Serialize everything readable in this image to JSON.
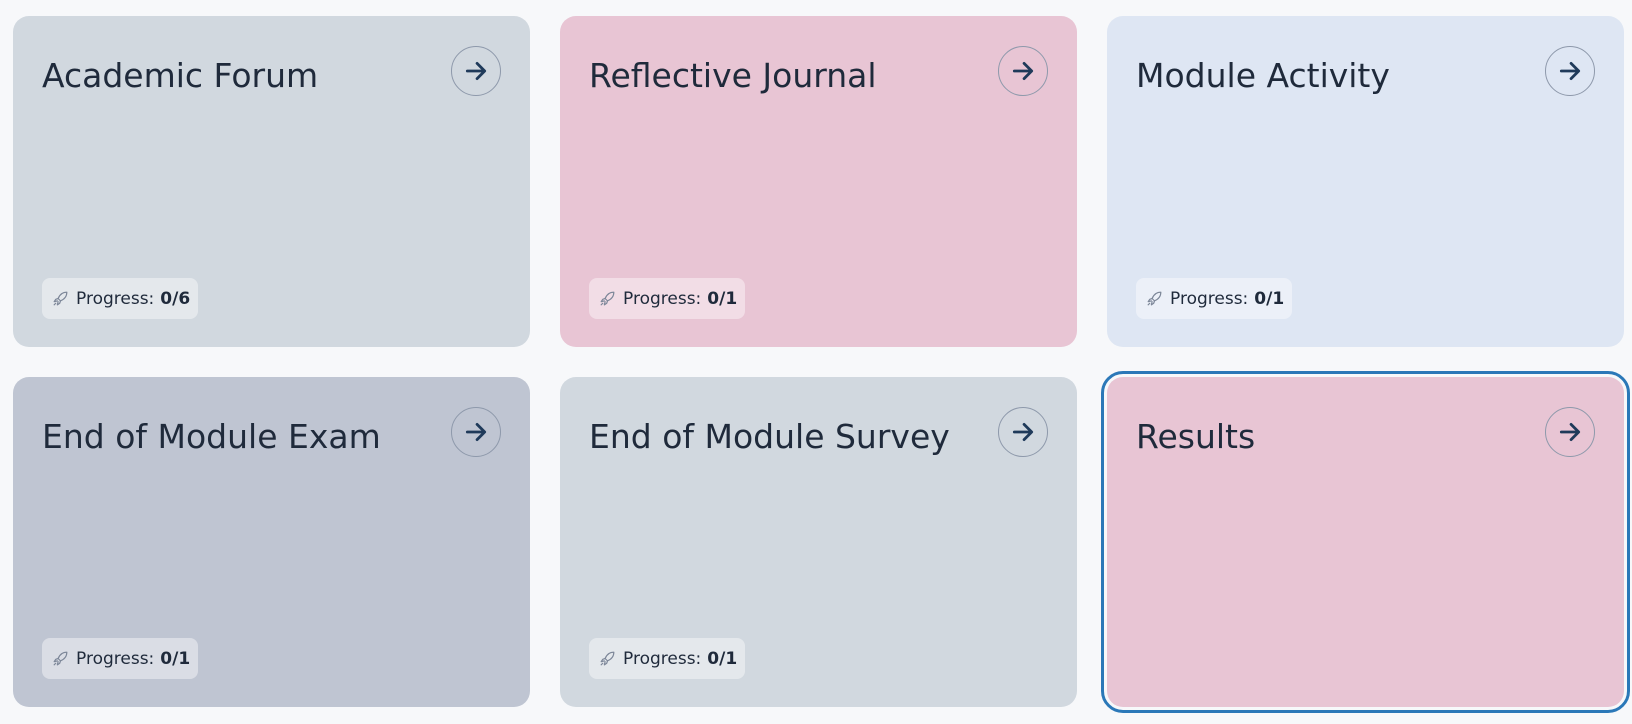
{
  "colors": {
    "page_bg": "#f7f8fa",
    "title": "#1f2a3b",
    "focus_ring": "#2b78b8",
    "arrow": "#1f3a5a"
  },
  "progress_label": "Progress:",
  "cards": [
    {
      "title": "Academic Forum",
      "progress": "0/6",
      "bg": "#d1d8df",
      "icon": "arrow-right-icon"
    },
    {
      "title": "Reflective Journal",
      "progress": "0/1",
      "bg": "#e8c5d4",
      "icon": "arrow-right-icon"
    },
    {
      "title": "Module Activity",
      "progress": "0/1",
      "bg": "#dee6f3",
      "icon": "arrow-right-icon"
    },
    {
      "title": "End of Module Exam",
      "progress": "0/1",
      "bg": "#bfc5d2",
      "icon": "arrow-right-icon"
    },
    {
      "title": "End of Module Survey",
      "progress": "0/1",
      "bg": "#d1d8df",
      "icon": "arrow-right-icon"
    },
    {
      "title": "Results",
      "progress": null,
      "bg": "#e8c5d4",
      "icon": "arrow-right-icon",
      "focused": true
    }
  ]
}
